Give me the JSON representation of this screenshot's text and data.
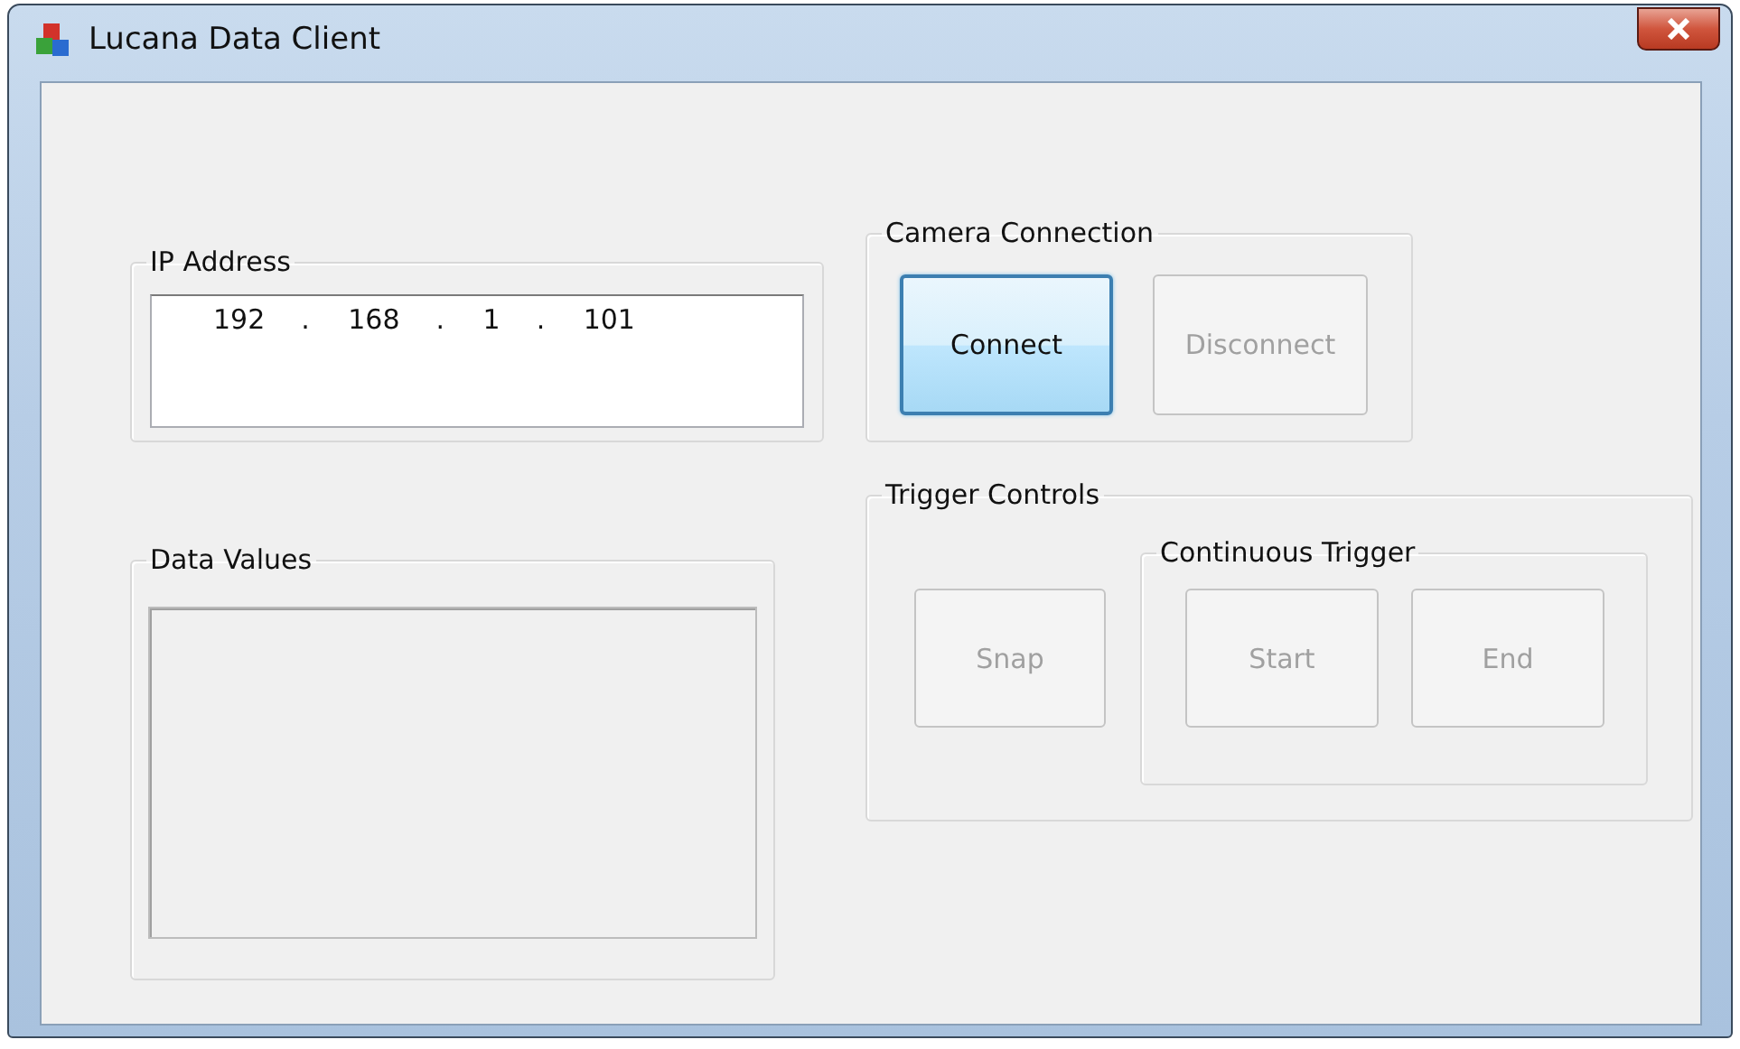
{
  "window": {
    "title": "Lucana Data Client"
  },
  "ip_group": {
    "label": "IP Address",
    "parts": [
      {
        "kind": "octet",
        "text": "192"
      },
      {
        "kind": "dot",
        "text": "."
      },
      {
        "kind": "octet",
        "text": "168"
      },
      {
        "kind": "dot",
        "text": "."
      },
      {
        "kind": "octet",
        "text": "1"
      },
      {
        "kind": "dot",
        "text": "."
      },
      {
        "kind": "octet",
        "text": "101"
      }
    ]
  },
  "data_group": {
    "label": "Data Values"
  },
  "camera_group": {
    "label": "Camera Connection",
    "buttons": [
      {
        "label": "Connect",
        "disabled": false,
        "focused": true
      },
      {
        "label": "Disconnect",
        "disabled": true,
        "focused": false
      }
    ]
  },
  "trigger_group": {
    "label": "Trigger Controls",
    "buttons": [
      {
        "label": "Snap",
        "disabled": true,
        "focused": false
      }
    ],
    "continuous": {
      "label": "Continuous Trigger",
      "buttons": [
        {
          "label": "Start",
          "disabled": true,
          "focused": false
        },
        {
          "label": "End",
          "disabled": true,
          "focused": false
        }
      ]
    }
  }
}
